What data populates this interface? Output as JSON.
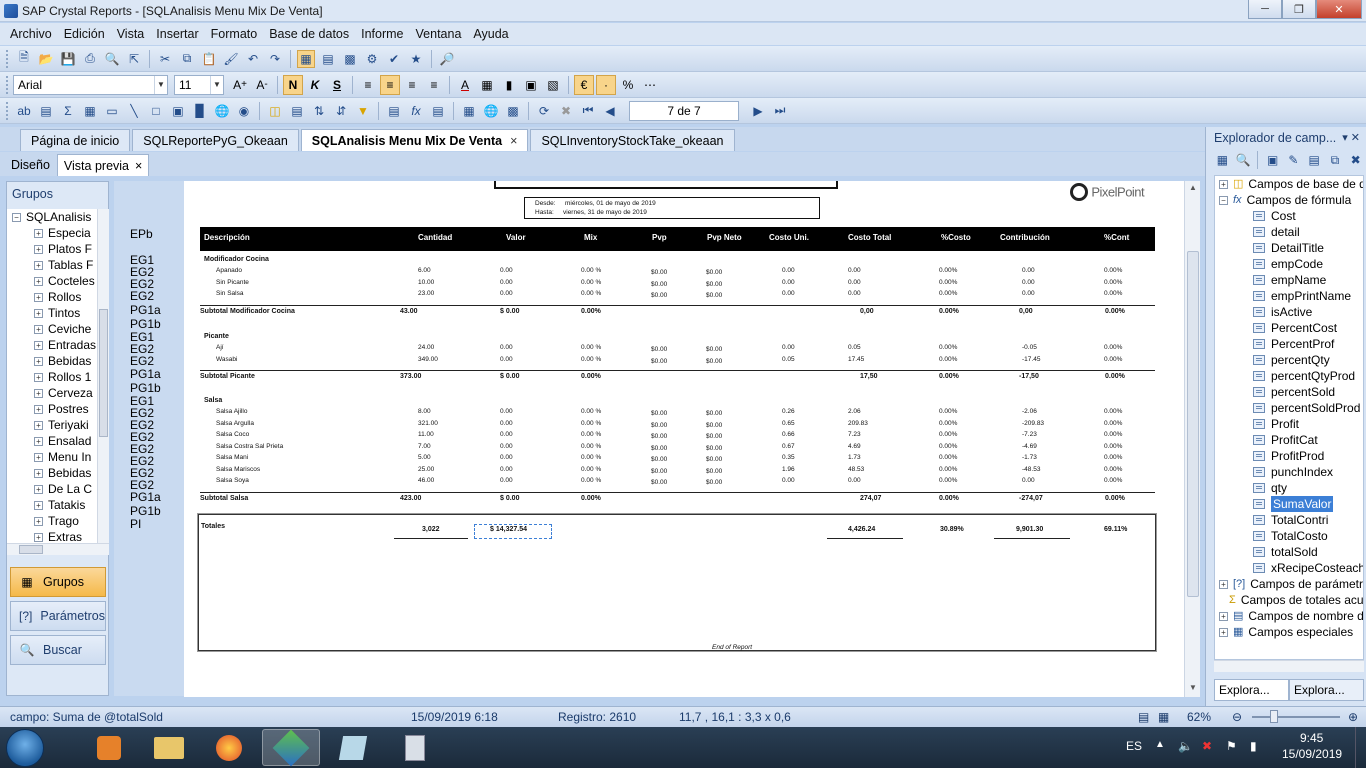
{
  "window": {
    "title": "SAP Crystal Reports - [SQLAnalisis Menu Mix De Venta]"
  },
  "menu": [
    "Archivo",
    "Edición",
    "Vista",
    "Insertar",
    "Formato",
    "Base de datos",
    "Informe",
    "Ventana",
    "Ayuda"
  ],
  "format_toolbar": {
    "font": "Arial",
    "size": "11"
  },
  "nav_toolbar": {
    "page": "7 de 7"
  },
  "doc_tabs": [
    {
      "label": "Página de inicio",
      "active": false
    },
    {
      "label": "SQLReportePyG_Okeaan",
      "active": false
    },
    {
      "label": "SQLAnalisis Menu Mix De Venta",
      "active": true,
      "close": "×"
    },
    {
      "label": "SQLInventoryStockTake_okeaan",
      "active": false
    }
  ],
  "view_tabs": {
    "design": "Diseño",
    "preview": "Vista previa",
    "close": "×"
  },
  "groups_panel": {
    "title": "Grupos",
    "root": "SQLAnalisis",
    "items": [
      "Especia",
      "Platos F",
      "Tablas F",
      "Cocteles",
      "Rollos",
      "Tintos",
      "Ceviche",
      "Entradas",
      "Bebidas",
      "Rollos 1",
      "Cerveza",
      "Postres",
      "Teriyaki",
      "Ensalad",
      "Menu In",
      "Bebidas",
      "De La C",
      "Tatakis",
      "Trago",
      "Extras"
    ],
    "buttons": {
      "groups": "Grupos",
      "params": "Parámetros",
      "search": "Buscar"
    }
  },
  "group_strip": {
    "labels": [
      "EPb",
      "EG1",
      "EG2",
      "EG2",
      "EG2",
      "PG1a",
      "PG1b",
      "EG1",
      "EG2",
      "EG2",
      "PG1a",
      "PG1b",
      "EG1",
      "EG2",
      "EG2",
      "EG2",
      "EG2",
      "EG2",
      "EG2",
      "EG2",
      "PG1a",
      "PG1b",
      "PI"
    ]
  },
  "report": {
    "logo": "PixelPoint",
    "date_from_label": "Desde:",
    "date_from": "miércoles, 01 de mayo de 2019",
    "date_to_label": "Hasta:",
    "date_to": "viernes, 31 de mayo de 2019",
    "columns": [
      "Descripción",
      "Cantidad",
      "Valor",
      "Mix",
      "Pvp",
      "Pvp Neto",
      "Costo Uni.",
      "Costo Total",
      "%Costo",
      "Contribución",
      "%Cont"
    ],
    "groups": [
      {
        "name": "Modificador Cocina",
        "rows": [
          [
            "Apanado",
            "6.00",
            "0.00",
            "0.00 %",
            "$0.00",
            "$0.00",
            "0.00",
            "0.00",
            "0.00%",
            "0.00",
            "0.00%"
          ],
          [
            "Sin Picante",
            "10.00",
            "0.00",
            "0.00 %",
            "$0.00",
            "$0.00",
            "0.00",
            "0.00",
            "0.00%",
            "0.00",
            "0.00%"
          ],
          [
            "Sin Salsa",
            "23.00",
            "0.00",
            "0.00 %",
            "$0.00",
            "$0.00",
            "0.00",
            "0.00",
            "0.00%",
            "0.00",
            "0.00%"
          ]
        ],
        "subtotal": [
          "Subtotal Modificador Cocina",
          "43.00",
          "$ 0.00",
          "0.00%",
          "0,00",
          "0.00%",
          "0,00",
          "0.00%"
        ]
      },
      {
        "name": "Picante",
        "rows": [
          [
            "Ají",
            "24.00",
            "0.00",
            "0.00 %",
            "$0.00",
            "$0.00",
            "0.00",
            "0.05",
            "0.00%",
            "-0.05",
            "0.00%"
          ],
          [
            "Wasabi",
            "349.00",
            "0.00",
            "0.00 %",
            "$0.00",
            "$0.00",
            "0.05",
            "17.45",
            "0.00%",
            "-17.45",
            "0.00%"
          ]
        ],
        "subtotal": [
          "Subtotal Picante",
          "373.00",
          "$ 0.00",
          "0.00%",
          "17,50",
          "0.00%",
          "-17,50",
          "0.00%"
        ]
      },
      {
        "name": "Salsa",
        "rows": [
          [
            "Salsa Ajillo",
            "8.00",
            "0.00",
            "0.00 %",
            "$0.00",
            "$0.00",
            "0.26",
            "2.06",
            "0.00%",
            "-2.06",
            "0.00%"
          ],
          [
            "Salsa Argulla",
            "321.00",
            "0.00",
            "0.00 %",
            "$0.00",
            "$0.00",
            "0.65",
            "209.83",
            "0.00%",
            "-209.83",
            "0.00%"
          ],
          [
            "Salsa Coco",
            "11.00",
            "0.00",
            "0.00 %",
            "$0.00",
            "$0.00",
            "0.66",
            "7.23",
            "0.00%",
            "-7.23",
            "0.00%"
          ],
          [
            "Salsa Costra Sal Prieta",
            "7.00",
            "0.00",
            "0.00 %",
            "$0.00",
            "$0.00",
            "0.67",
            "4.69",
            "0.00%",
            "-4.69",
            "0.00%"
          ],
          [
            "Salsa Mani",
            "5.00",
            "0.00",
            "0.00 %",
            "$0.00",
            "$0.00",
            "0.35",
            "1.73",
            "0.00%",
            "-1.73",
            "0.00%"
          ],
          [
            "Salsa Mariscos",
            "25.00",
            "0.00",
            "0.00 %",
            "$0.00",
            "$0.00",
            "1.96",
            "48.53",
            "0.00%",
            "-48.53",
            "0.00%"
          ],
          [
            "Salsa Soya",
            "46.00",
            "0.00",
            "0.00 %",
            "$0.00",
            "$0.00",
            "0.00",
            "0.00",
            "0.00%",
            "0.00",
            "0.00%"
          ]
        ],
        "subtotal": [
          "Subtotal Salsa",
          "423.00",
          "$ 0.00",
          "0.00%",
          "274,07",
          "0.00%",
          "-274,07",
          "0.00%"
        ]
      }
    ],
    "totals": {
      "label": "Totales",
      "qty": "3,022",
      "valor": "$ 14,327.54",
      "costo": "4,426.24",
      "pct_costo": "30.89%",
      "contrib": "9,901.30",
      "pct_cont": "69.11%"
    },
    "end": "End of Report"
  },
  "explorer": {
    "title": "Explorador de camp...",
    "header_btns": "▾ ✕",
    "db_fields": "Campos de base de da",
    "formula_fields": "Campos de fórmula",
    "formulas": [
      "Cost",
      "detail",
      "DetailTitle",
      "empCode",
      "empName",
      "empPrintName",
      "isActive",
      "PercentCost",
      "PercentProf",
      "percentQty",
      "percentQtyProd",
      "percentSold",
      "percentSoldProd",
      "Profit",
      "ProfitCat",
      "ProfitProd",
      "punchIndex",
      "qty",
      "SumaValor",
      "TotalContri",
      "TotalCosto",
      "totalSold",
      "xRecipeCosteach"
    ],
    "selected": "SumaValor",
    "others": [
      "Campos de parámetro",
      "Campos de totales acu",
      "Campos de nombre de",
      "Campos especiales"
    ],
    "tabs": [
      "Explora...",
      "Explora..."
    ]
  },
  "status": {
    "field": "campo: Suma de @totalSold",
    "date": "15/09/2019  6:18",
    "record": "Registro:  2610",
    "coords": "11,7 , 16,1 : 3,3 x 0,6",
    "zoom": "62%"
  },
  "taskbar": {
    "lang": "ES",
    "time": "9:45",
    "date": "15/09/2019"
  }
}
